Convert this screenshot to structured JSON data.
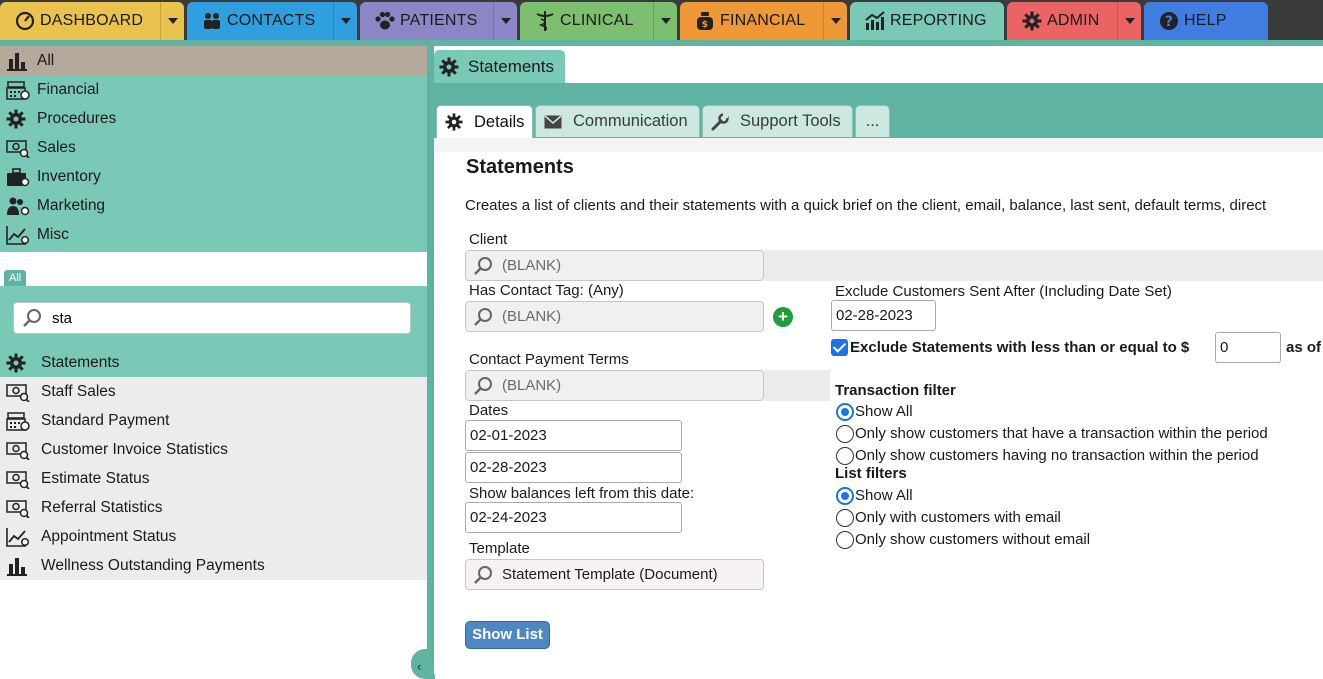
{
  "nav": {
    "tabs": [
      {
        "label": "DASHBOARD",
        "icon": "gauge-icon",
        "color": "#e9c34d"
      },
      {
        "label": "CONTACTS",
        "icon": "people-icon",
        "color": "#2f9fe0"
      },
      {
        "label": "PATIENTS",
        "icon": "paw-icon",
        "color": "#8c86c6"
      },
      {
        "label": "CLINICAL",
        "icon": "caduceus-icon",
        "color": "#7cbf6e"
      },
      {
        "label": "FINANCIAL",
        "icon": "money-bag-icon",
        "color": "#ef9837"
      },
      {
        "label": "REPORTING",
        "icon": "chart-up-icon",
        "color": "#79c9b6"
      },
      {
        "label": "ADMIN",
        "icon": "gear-icon",
        "color": "#ea6464"
      },
      {
        "label": "HELP",
        "icon": "question-icon",
        "color": "#3f7ee0"
      }
    ]
  },
  "sidebar": {
    "categories": [
      {
        "label": "All",
        "icon": "bar-chart-icon"
      },
      {
        "label": "Financial",
        "icon": "cash-register-icon"
      },
      {
        "label": "Procedures",
        "icon": "gear-icon"
      },
      {
        "label": "Sales",
        "icon": "money-search-icon"
      },
      {
        "label": "Inventory",
        "icon": "briefcase-icon"
      },
      {
        "label": "Marketing",
        "icon": "people-search-icon"
      },
      {
        "label": "Misc",
        "icon": "line-chart-icon"
      }
    ],
    "filter_tag": "All",
    "search": {
      "value": "sta"
    },
    "results": [
      {
        "label": "Statements",
        "icon": "gear-icon"
      },
      {
        "label": "Staff Sales",
        "icon": "money-search-icon"
      },
      {
        "label": "Standard Payment",
        "icon": "cash-register-icon"
      },
      {
        "label": "Customer Invoice Statistics",
        "icon": "money-search-icon"
      },
      {
        "label": "Estimate Status",
        "icon": "money-search-icon"
      },
      {
        "label": "Referral Statistics",
        "icon": "money-search-icon"
      },
      {
        "label": "Appointment Status",
        "icon": "line-chart-icon"
      },
      {
        "label": "Wellness Outstanding Payments",
        "icon": "bar-chart-icon"
      }
    ],
    "collapse_glyph": "‹"
  },
  "main": {
    "page_tab": "Statements",
    "subtabs": [
      "Details",
      "Communication",
      "Support Tools",
      "..."
    ],
    "heading": "Statements",
    "description": "Creates a list of clients and their statements with a quick brief on the client, email, balance, last sent, default terms, direct",
    "form": {
      "client_label": "Client",
      "client_value": "(BLANK)",
      "contact_tag_label": "Has Contact Tag: (Any)",
      "contact_tag_value": "(BLANK)",
      "payment_terms_label": "Contact Payment Terms",
      "payment_terms_value": "(BLANK)",
      "dates_label": "Dates",
      "date_from": "02-01-2023",
      "date_to": "02-28-2023",
      "balances_label": "Show balances left from this date:",
      "balances_date": "02-24-2023",
      "template_label": "Template",
      "template_value": "Statement Template (Document)",
      "show_list": "Show List",
      "exclude_sent_label": "Exclude Customers Sent After (Including Date Set)",
      "exclude_sent_date": "02-28-2023",
      "exclude_less_label": "Exclude Statements with less than or equal to $",
      "exclude_less_value": "0",
      "exclude_less_suffix": "as of",
      "transaction_filter_label": "Transaction filter",
      "transaction_options": [
        "Show All",
        "Only show customers that have a transaction within the period",
        "Only show customers having no transaction within the period"
      ],
      "list_filters_label": "List filters",
      "list_options": [
        "Show All",
        "Only with customers with email",
        "Only show customers without email"
      ]
    }
  }
}
